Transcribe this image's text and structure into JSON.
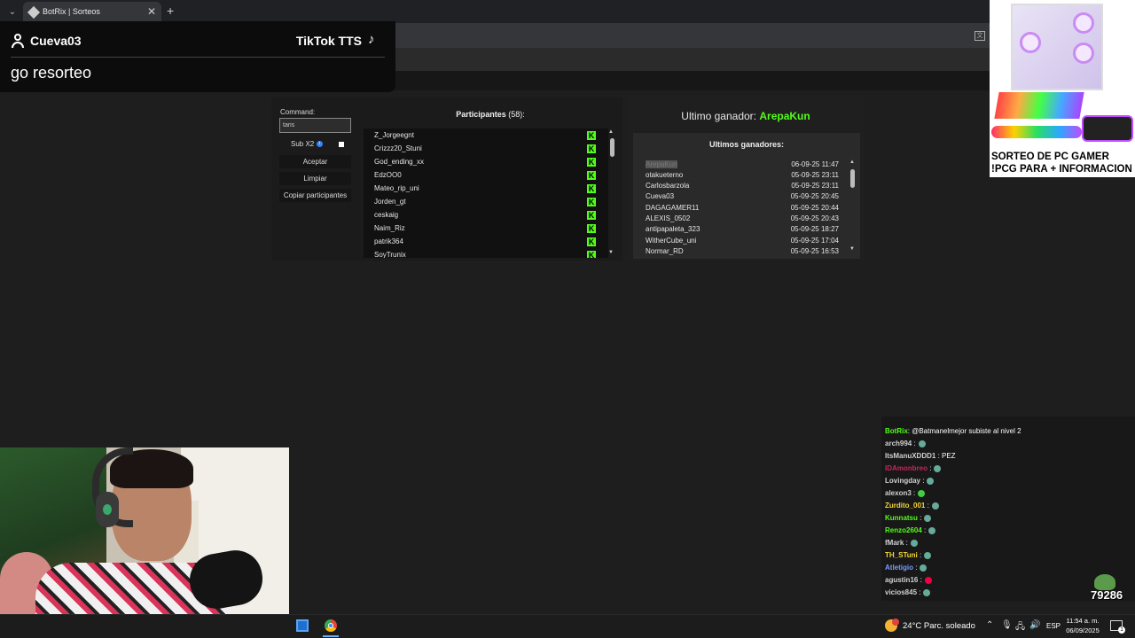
{
  "browser": {
    "tab_title": "BotRix | Sorteos",
    "tab_close": "✕",
    "new_tab": "+",
    "tab_menu": "⌄"
  },
  "tts": {
    "username": "Cueva03",
    "label": "TikTok TTS",
    "message": "go resorteo"
  },
  "sorteo": {
    "command_label": "Command:",
    "command_value": "taris",
    "subx2_label": "Sub X2",
    "accept_label": "Aceptar",
    "clear_label": "Limpiar",
    "copy_label": "Copiar participantes",
    "participants_title": "Participantes",
    "participants_count": "(58):",
    "participants": [
      "Z_Jorgeegnt",
      "Crizzz20_Stuni",
      "God_ending_xx",
      "EdzOO0",
      "Mateo_rip_uni",
      "Jorden_gt",
      "ceskaig",
      "Naim_Riz",
      "patrik364",
      "SoyTrunix"
    ],
    "last_winner_label": "Ultimo ganador:",
    "last_winner": "ArepaKun",
    "winners_title": "Ultimos ganadores:",
    "winners": [
      {
        "name": "ArepaKun",
        "date": "06-09-25 11:47"
      },
      {
        "name": "otakueterno",
        "date": "05-09-25 23:11"
      },
      {
        "name": "Carlosbarzola",
        "date": "05-09-25 23:11"
      },
      {
        "name": "Cueva03",
        "date": "05-09-25 20:45"
      },
      {
        "name": "DAGAGAMER11",
        "date": "05-09-25 20:44"
      },
      {
        "name": "ALEXIS_0502",
        "date": "05-09-25 20:43"
      },
      {
        "name": "antipapaleta_323",
        "date": "05-09-25 18:27"
      },
      {
        "name": "WitherCube_uni",
        "date": "05-09-25 17:04"
      },
      {
        "name": "Normar_RD",
        "date": "05-09-25 16:53"
      }
    ]
  },
  "ad": {
    "line1": "SORTEO DE PC GAMER",
    "line2": "!PCG PARA + INFORMACION"
  },
  "chat": {
    "lines": [
      {
        "user": "BotRix",
        "msg": ": @Batmanelmejor subiste al nivel 2",
        "color": "#53fc18"
      },
      {
        "user": "arch994",
        "msg": " :",
        "color": "#d0d0d0"
      },
      {
        "user": "ItsManuXDDD1",
        "msg": " : PEZ",
        "color": "#d0d0d0"
      },
      {
        "user": "IDAmonbreo",
        "msg": " :",
        "color": "#c0285a"
      },
      {
        "user": "Lovingday",
        "msg": " :",
        "color": "#d0d0d0"
      },
      {
        "user": "alexon3",
        "msg": " :",
        "color": "#d0d0d0"
      },
      {
        "user": "Zurdito_001",
        "msg": " :",
        "color": "#f2d73a"
      },
      {
        "user": "Kunnatsu",
        "msg": " :",
        "color": "#53fc18"
      },
      {
        "user": "Renzo2604",
        "msg": " :",
        "color": "#53fc18"
      },
      {
        "user": "fMark",
        "msg": " :",
        "color": "#d0d0d0"
      },
      {
        "user": "TH_STuni",
        "msg": " :",
        "color": "#f2d73a"
      },
      {
        "user": "Atletigio",
        "msg": " :",
        "color": "#7a9bff"
      },
      {
        "user": "agustin16",
        "msg": " :",
        "color": "#d0d0d0"
      },
      {
        "user": "vicios845",
        "msg": " :",
        "color": "#d0d0d0"
      }
    ],
    "counter": "79286"
  },
  "taskbar": {
    "weather": "24°C  Parc. soleado",
    "lang": "ESP",
    "time": "11:54 a. m.",
    "date": "06/09/2025",
    "notify_count": "1"
  }
}
